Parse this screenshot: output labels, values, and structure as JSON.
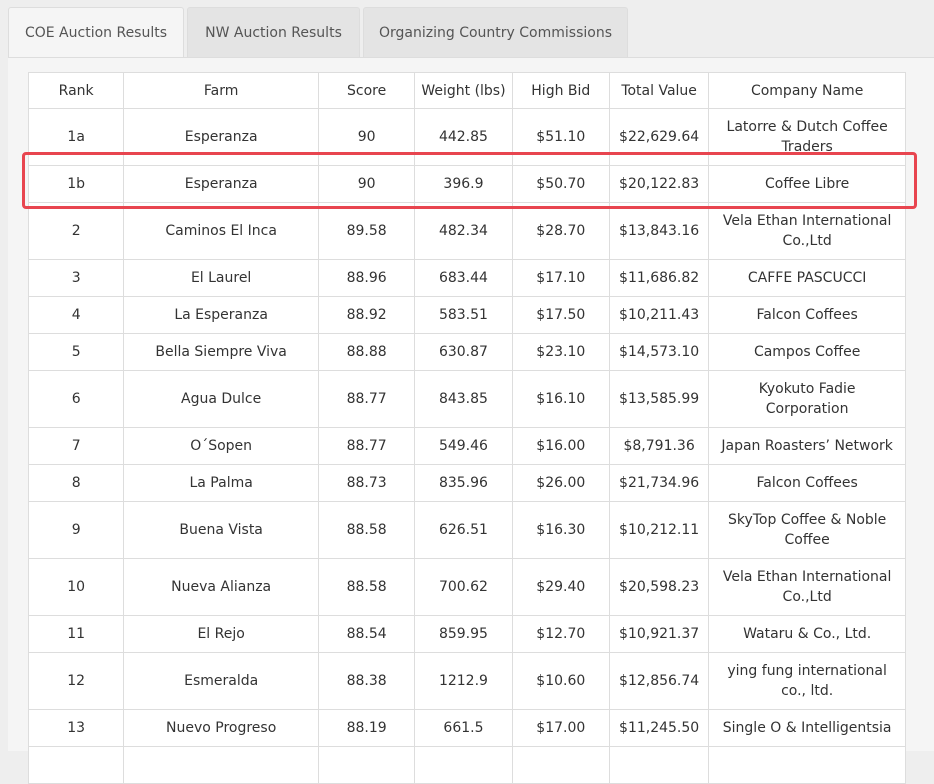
{
  "tabs": [
    {
      "label": "COE Auction Results",
      "active": true
    },
    {
      "label": "NW Auction Results",
      "active": false
    },
    {
      "label": "Organizing Country Commissions",
      "active": false
    }
  ],
  "table": {
    "headers": [
      "Rank",
      "Farm",
      "Score",
      "Weight (lbs)",
      "High Bid",
      "Total Value",
      "Company Name"
    ],
    "rows": [
      [
        "1a",
        "Esperanza",
        "90",
        "442.85",
        "$51.10",
        "$22,629.64",
        "Latorre & Dutch Coffee Traders"
      ],
      [
        "1b",
        "Esperanza",
        "90",
        "396.9",
        "$50.70",
        "$20,122.83",
        "Coffee Libre"
      ],
      [
        "2",
        "Caminos El Inca",
        "89.58",
        "482.34",
        "$28.70",
        "$13,843.16",
        "Vela Ethan International Co.,Ltd"
      ],
      [
        "3",
        "El Laurel",
        "88.96",
        "683.44",
        "$17.10",
        "$11,686.82",
        "CAFFE PASCUCCI"
      ],
      [
        "4",
        "La Esperanza",
        "88.92",
        "583.51",
        "$17.50",
        "$10,211.43",
        "Falcon Coffees"
      ],
      [
        "5",
        "Bella Siempre Viva",
        "88.88",
        "630.87",
        "$23.10",
        "$14,573.10",
        "Campos Coffee"
      ],
      [
        "6",
        "Agua Dulce",
        "88.77",
        "843.85",
        "$16.10",
        "$13,585.99",
        "Kyokuto Fadie Corporation"
      ],
      [
        "7",
        "O´Sopen",
        "88.77",
        "549.46",
        "$16.00",
        "$8,791.36",
        "Japan Roasters’ Network"
      ],
      [
        "8",
        "La Palma",
        "88.73",
        "835.96",
        "$26.00",
        "$21,734.96",
        "Falcon Coffees"
      ],
      [
        "9",
        "Buena Vista",
        "88.58",
        "626.51",
        "$16.30",
        "$10,212.11",
        "SkyTop Coffee & Noble Coffee"
      ],
      [
        "10",
        "Nueva Alianza",
        "88.58",
        "700.62",
        "$29.40",
        "$20,598.23",
        "Vela Ethan International Co.,Ltd"
      ],
      [
        "11",
        "El Rejo",
        "88.54",
        "859.95",
        "$12.70",
        "$10,921.37",
        "Wataru & Co., Ltd."
      ],
      [
        "12",
        "Esmeralda",
        "88.38",
        "1212.9",
        "$10.60",
        "$12,856.74",
        "ying fung international co., ltd."
      ],
      [
        "13",
        "Nuevo Progreso",
        "88.19",
        "661.5",
        "$17.00",
        "$11,245.50",
        "Single O & Intelligentsia"
      ],
      [
        "",
        "",
        "",
        "",
        "",
        "",
        ""
      ]
    ],
    "highlighted_rank": "1b",
    "highlight_color": "#e8454f"
  }
}
